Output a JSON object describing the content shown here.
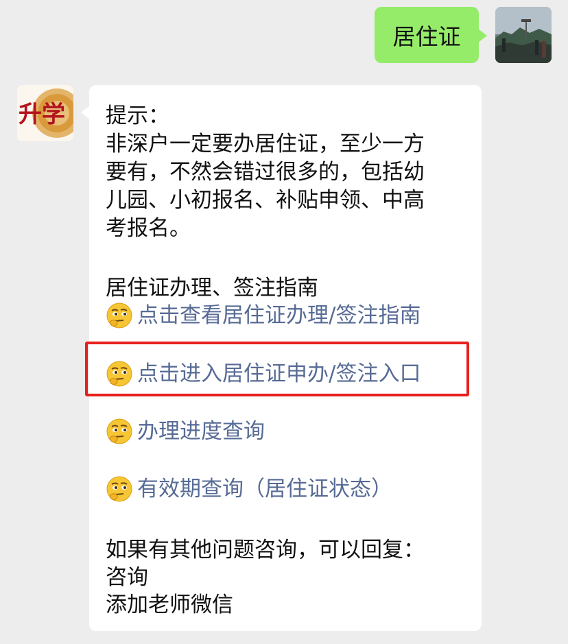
{
  "outgoing": {
    "text": "居住证"
  },
  "incoming": {
    "lines": [
      "提示：",
      "非深户一定要办居住证，至少一方",
      "要有，不然会错过很多的，包括幼",
      "儿园、小初报名、补贴申领、中高",
      "考报名。"
    ],
    "guide_heading": "居住证办理、签注指南",
    "links": [
      "点击查看居住证办理/签注指南",
      "点击进入居住证申办/签注入口",
      "办理进度查询",
      "有效期查询（居住证状态）"
    ],
    "footer_lines": [
      "如果有其他问题咨询，可以回复：",
      "咨询",
      "添加老师微信"
    ]
  },
  "bot_avatar": {
    "logo_text": "升学"
  },
  "icons": {
    "link_emoji": "thinking-face-icon"
  },
  "colors": {
    "background": "#ededed",
    "outgoing_bubble": "#95ec69",
    "incoming_bubble": "#ffffff",
    "link": "#576b95",
    "highlight": "#e8201c"
  }
}
